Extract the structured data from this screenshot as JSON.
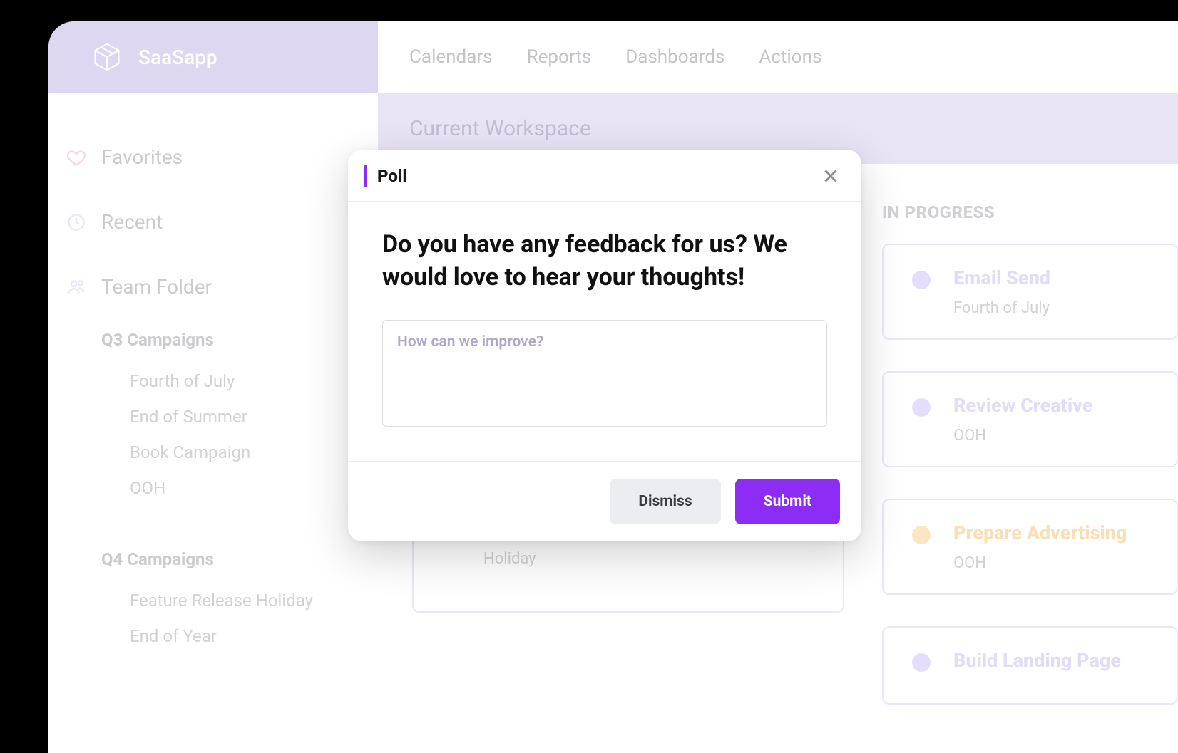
{
  "brand": {
    "name": "SaaSapp"
  },
  "topnav": {
    "items": [
      "Calendars",
      "Reports",
      "Dashboards",
      "Actions"
    ]
  },
  "workspace": {
    "label": "Current Workspace"
  },
  "sidebar": {
    "favorites": "Favorites",
    "recent": "Recent",
    "team_folder": "Team Folder",
    "groups": [
      {
        "title": "Q3 Campaigns",
        "items": [
          "Fourth of July",
          "End of Summer",
          "Book Campaign",
          "OOH"
        ]
      },
      {
        "title": "Q4 Campaigns",
        "items": [
          "Feature Release Holiday",
          "End of Year"
        ]
      }
    ]
  },
  "columns": {
    "left": {
      "header": "",
      "cards": [
        {
          "title": "",
          "sub": "Holiday",
          "color": "purple"
        }
      ]
    },
    "right": {
      "header": "IN PROGRESS",
      "cards": [
        {
          "title": "Email Send",
          "sub": "Fourth of July",
          "color": "purple"
        },
        {
          "title": "Review Creative",
          "sub": "OOH",
          "color": "purple"
        },
        {
          "title": "Prepare Advertising",
          "sub": "OOH",
          "color": "orange"
        },
        {
          "title": "Build Landing Page",
          "sub": "",
          "color": "purple"
        }
      ]
    }
  },
  "modal": {
    "title": "Poll",
    "question": "Do you have any feedback for us? We would love to hear your thoughts!",
    "placeholder": "How can we improve?",
    "dismiss": "Dismiss",
    "submit": "Submit"
  }
}
